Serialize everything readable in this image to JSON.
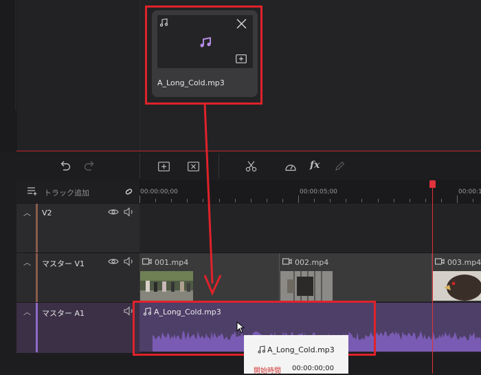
{
  "media_card": {
    "filename": "A_Long_Cold.mp3",
    "icons": {
      "type": "music-note-icon",
      "close": "close-icon",
      "center": "music-note-icon",
      "add": "add-to-timeline-icon"
    }
  },
  "toolbar": {
    "icons": [
      "undo-icon",
      "redo-icon",
      "add-clip-icon",
      "delete-clip-icon",
      "cut-icon",
      "speed-icon",
      "effects-icon",
      "edit-icon"
    ],
    "fx_label": "fx"
  },
  "timeline": {
    "add_track_label": "トラック追加",
    "timecodes": [
      "00:00:00;00",
      "00:00:05;00",
      "00:00:1"
    ]
  },
  "tracks": {
    "v2": {
      "name": "V2"
    },
    "v1": {
      "name": "マスター V1",
      "clips": [
        "001.mp4",
        "002.mp4",
        "003.mp4"
      ]
    },
    "a1": {
      "name": "マスター A1",
      "clip": "A_Long_Cold.mp3"
    }
  },
  "tooltip": {
    "title": "A_Long_Cold.mp3",
    "start_label": "開始時間",
    "start_value": "00:00:00;00"
  },
  "colors": {
    "accent_red": "#e0222a",
    "audio_clip": "#4e3f68",
    "waveform": "#7a5bb3"
  }
}
